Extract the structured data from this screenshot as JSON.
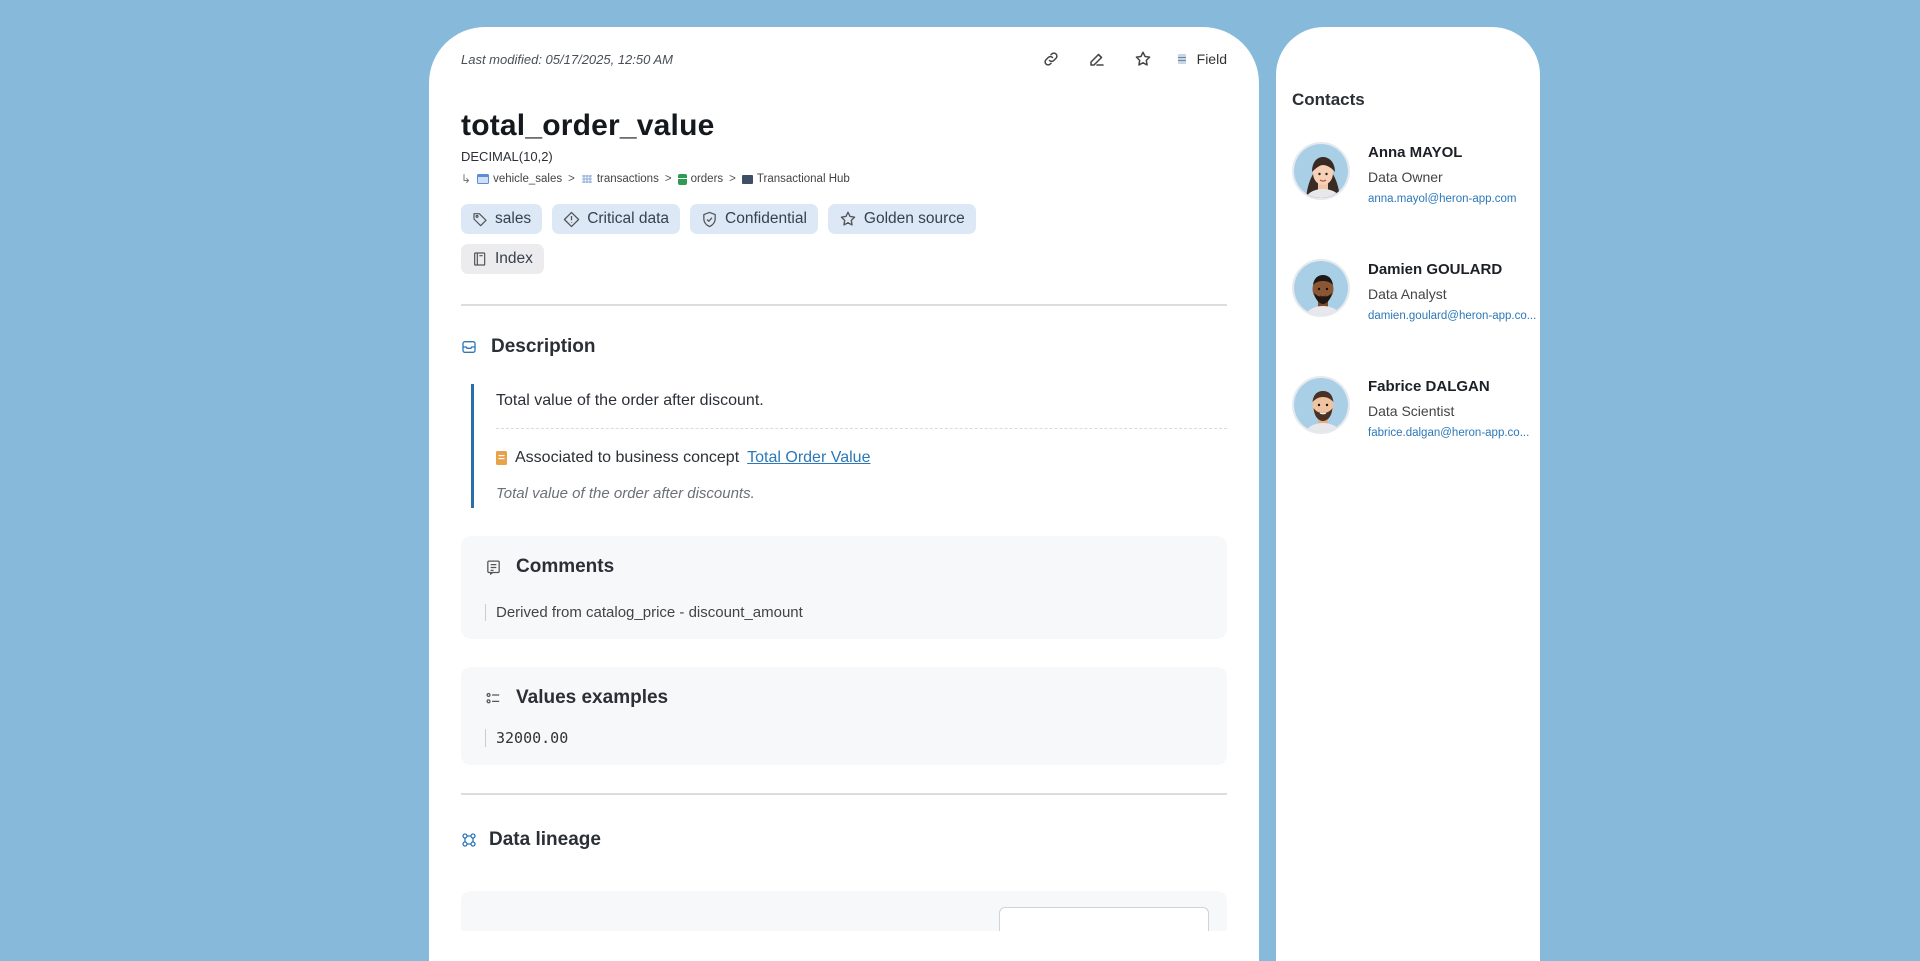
{
  "header": {
    "last_modified": "Last modified: 05/17/2025, 12:50 AM",
    "field_label": "Field",
    "icons": [
      "link-icon",
      "edit-icon",
      "star-icon",
      "field-icon"
    ]
  },
  "field": {
    "name": "total_order_value",
    "type": "DECIMAL(10,2)",
    "breadcrumb": [
      "vehicle_sales",
      "transactions",
      "orders",
      "Transactional Hub"
    ],
    "breadcrumb_sep": ">"
  },
  "tags": [
    {
      "label": "sales",
      "icon": "tag-icon"
    },
    {
      "label": "Critical data",
      "icon": "diamond-alert-icon"
    },
    {
      "label": "Confidential",
      "icon": "shield-check-icon"
    },
    {
      "label": "Golden source",
      "icon": "star-icon"
    },
    {
      "label": "Index",
      "icon": "book-icon"
    }
  ],
  "description": {
    "heading": "Description",
    "text": "Total value of the order after discount.",
    "concept_prefix": "Associated to business concept",
    "concept_link": "Total Order Value",
    "concept_description": "Total value of the order after discounts."
  },
  "comments": {
    "heading": "Comments",
    "text": "Derived from catalog_price - discount_amount"
  },
  "values_examples": {
    "heading": "Values examples",
    "value": "32000.00"
  },
  "lineage": {
    "heading": "Data lineage"
  },
  "contacts": {
    "title": "Contacts",
    "items": [
      {
        "name": "Anna MAYOL",
        "role": "Data Owner",
        "email": "anna.mayol@heron-app.com"
      },
      {
        "name": "Damien GOULARD",
        "role": "Data Analyst",
        "email": "damien.goulard@heron-app.co..."
      },
      {
        "name": "Fabrice DALGAN",
        "role": "Data Scientist",
        "email": "fabrice.dalgan@heron-app.co..."
      }
    ]
  },
  "colors": {
    "background": "#86b9da",
    "accent": "#2c78b8",
    "tag_bg": "#dde8f6"
  }
}
